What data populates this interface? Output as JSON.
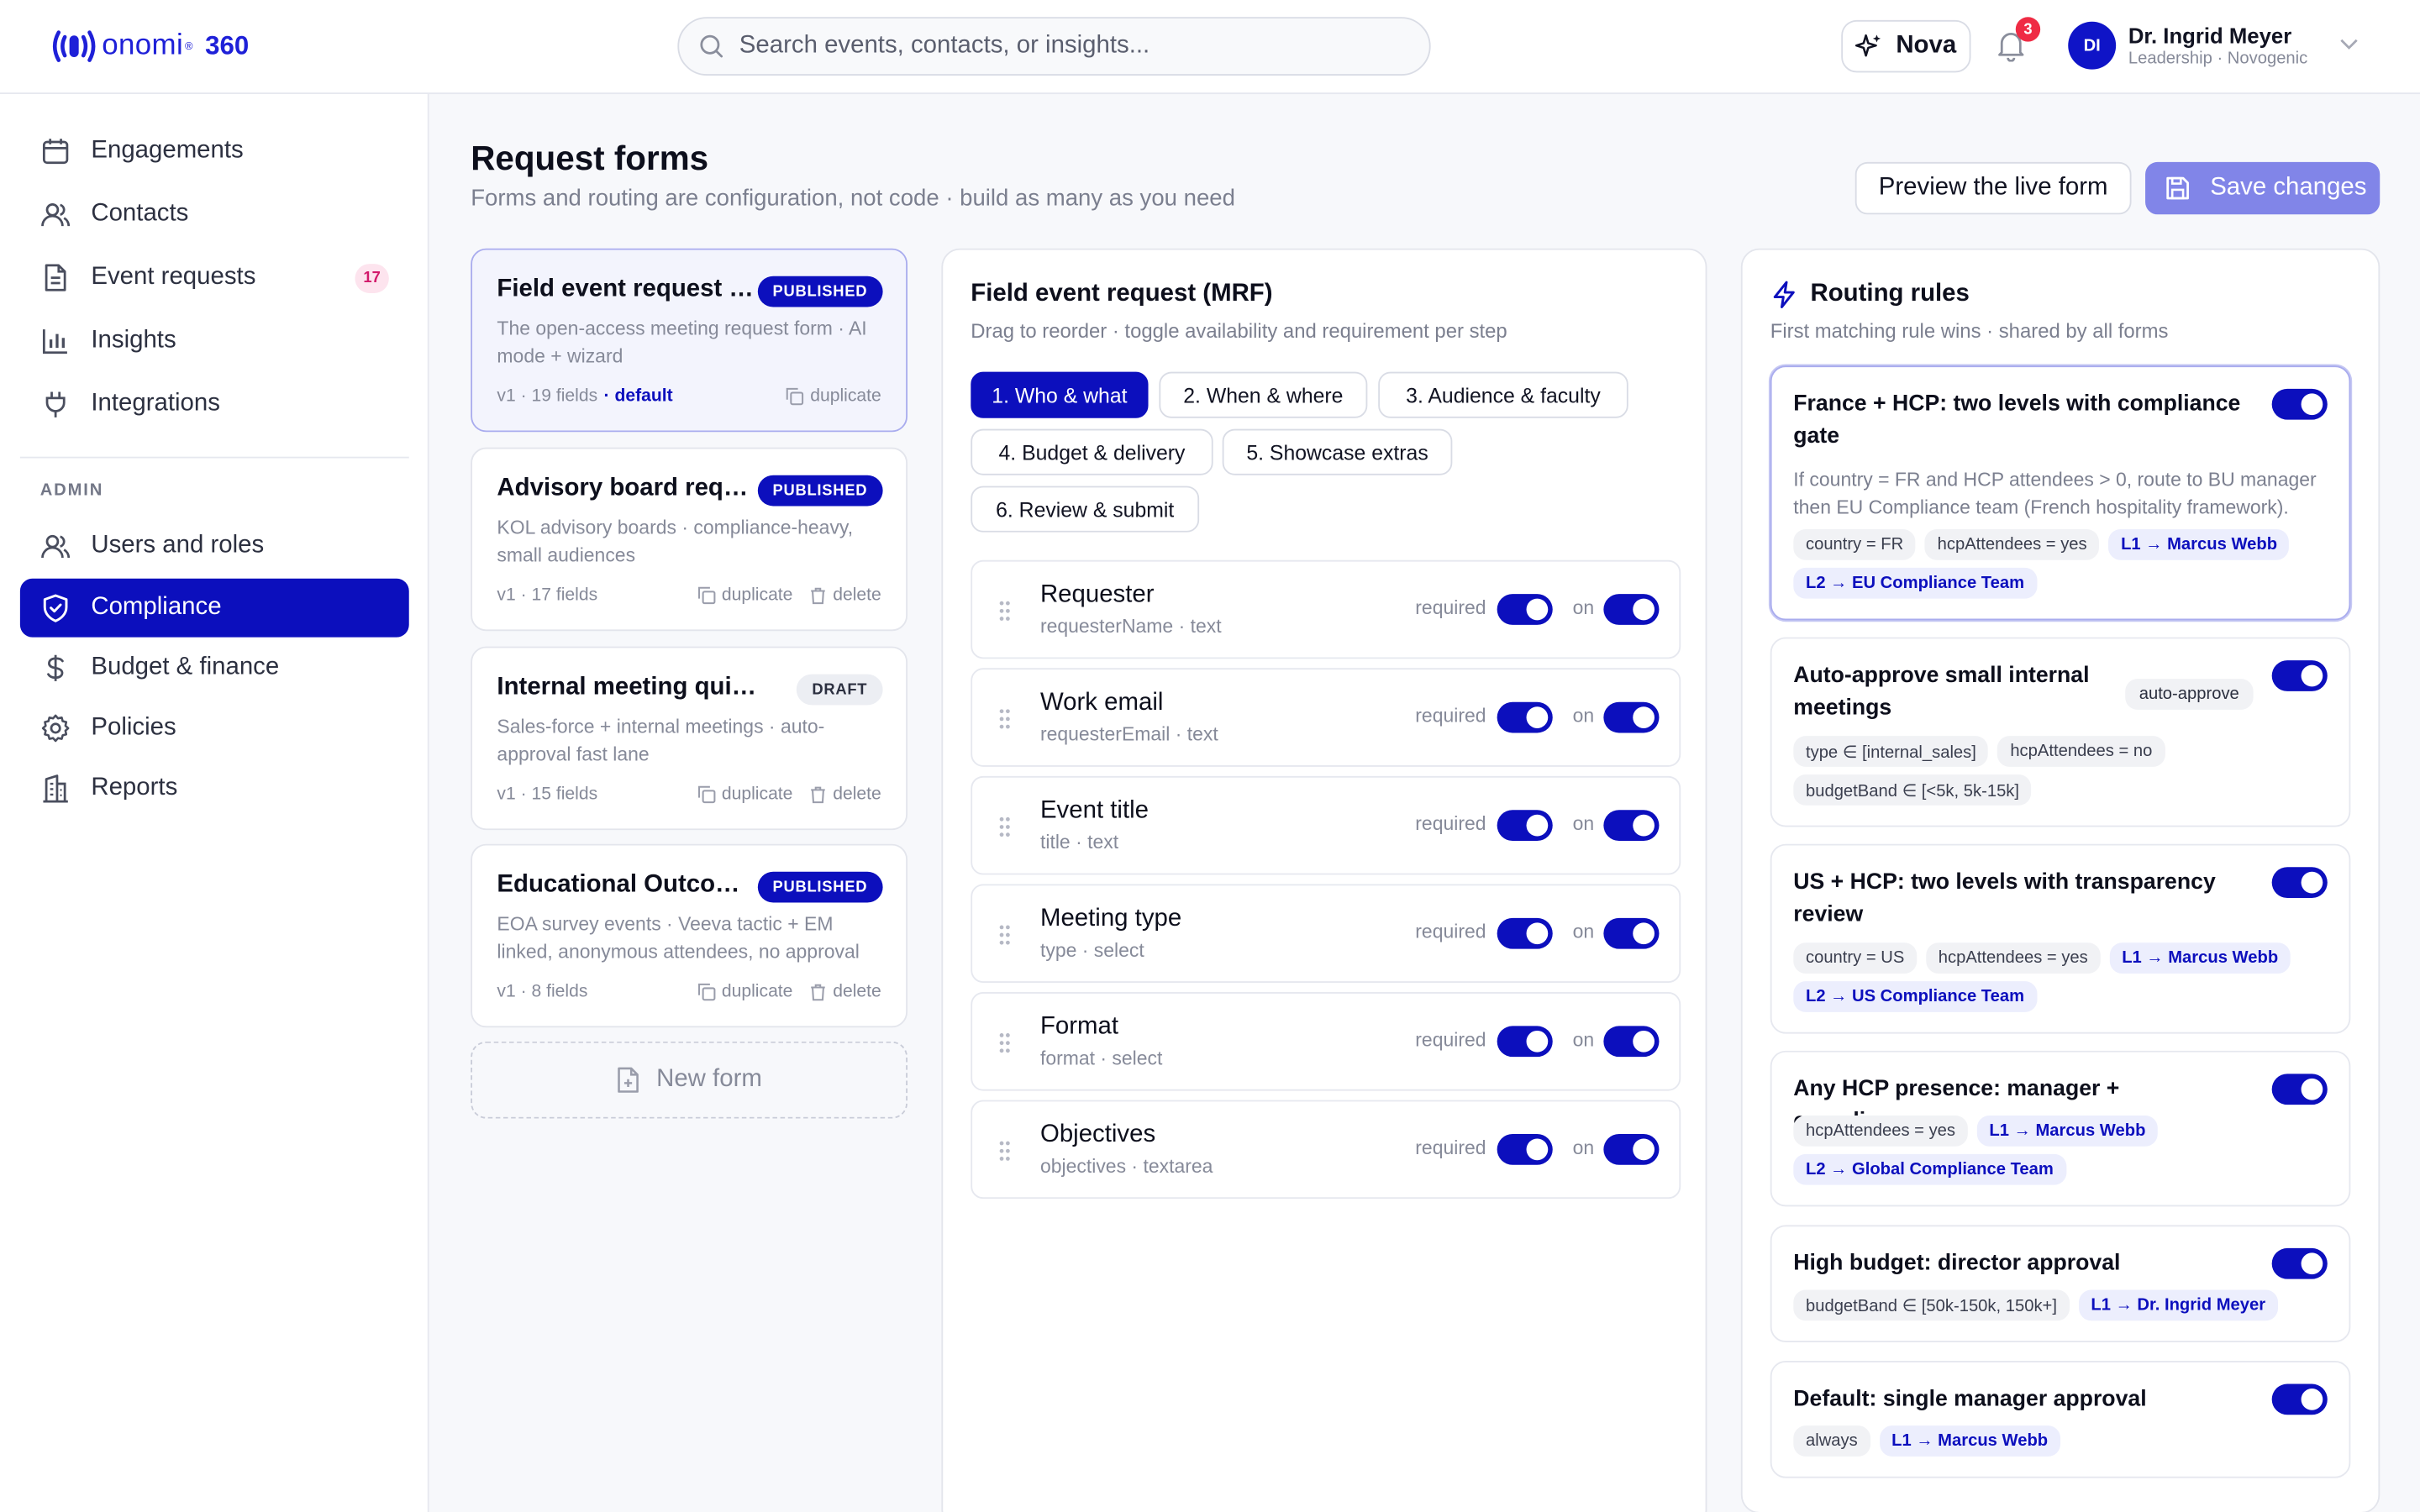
{
  "brand": {
    "name": "onomi",
    "suffix": "360"
  },
  "search": {
    "placeholder": "Search events, contacts, or insights..."
  },
  "header": {
    "assistant_label": "Nova",
    "notification_count": "3",
    "user_initials": "DI",
    "user_name": "Dr. Ingrid Meyer",
    "user_role": "Leadership · Novogenic"
  },
  "sidebar": {
    "items": [
      {
        "label": "Engagements",
        "icon": "calendar-icon"
      },
      {
        "label": "Contacts",
        "icon": "users-icon"
      },
      {
        "label": "Event requests",
        "icon": "document-icon",
        "badge": "17"
      },
      {
        "label": "Insights",
        "icon": "bar-chart-icon"
      },
      {
        "label": "Integrations",
        "icon": "plug-icon"
      }
    ],
    "admin_label": "ADMIN",
    "admin_items": [
      {
        "label": "Users and roles",
        "icon": "users-icon"
      },
      {
        "label": "Compliance",
        "icon": "shield-icon",
        "active": true
      },
      {
        "label": "Budget & finance",
        "icon": "dollar-icon"
      },
      {
        "label": "Policies",
        "icon": "gear-icon"
      },
      {
        "label": "Reports",
        "icon": "building-icon"
      }
    ]
  },
  "page": {
    "title": "Request forms",
    "subtitle": "Forms and routing are configuration, not code · build as many as you need",
    "preview_label": "Preview the live form",
    "save_label": "Save changes"
  },
  "forms": [
    {
      "title": "Field event request (MRF)",
      "status": "PUBLISHED",
      "desc": "The open-access meeting request form · AI mode + wizard",
      "meta": "v1 · 19 fields",
      "default": "· default",
      "duplicate": "duplicate"
    },
    {
      "title": "Advisory board request",
      "status": "PUBLISHED",
      "desc": "KOL advisory boards · compliance-heavy, small audiences",
      "meta": "v1 · 17 fields",
      "duplicate": "duplicate",
      "delete": "delete"
    },
    {
      "title": "Internal meeting quick form",
      "status": "DRAFT",
      "desc": "Sales-force + internal meetings · auto-approval fast lane",
      "meta": "v1 · 15 fields",
      "duplicate": "duplicate",
      "delete": "delete"
    },
    {
      "title": "Educational Outcomes Assessment",
      "status": "PUBLISHED",
      "desc": "EOA survey events · Veeva tactic + EM linked, anonymous attendees, no approval",
      "meta": "v1 · 8 fields",
      "duplicate": "duplicate",
      "delete": "delete"
    }
  ],
  "new_form_label": "New form",
  "editor": {
    "title": "Field event request (MRF)",
    "subtitle": "Drag to reorder · toggle availability and requirement per step",
    "steps": [
      "1. Who & what",
      "2. When & where",
      "3. Audience & faculty",
      "4. Budget & delivery",
      "5. Showcase extras",
      "6. Review & submit"
    ],
    "required_label": "required",
    "on_label": "on",
    "fields": [
      {
        "name": "Requester",
        "key": "requesterName · text"
      },
      {
        "name": "Work email",
        "key": "requesterEmail · text"
      },
      {
        "name": "Event title",
        "key": "title · text"
      },
      {
        "name": "Meeting type",
        "key": "type · select"
      },
      {
        "name": "Format",
        "key": "format · select"
      },
      {
        "name": "Objectives",
        "key": "objectives · textarea"
      }
    ]
  },
  "routing": {
    "title": "Routing rules",
    "subtitle": "First matching rule wins · shared by all forms",
    "rules": [
      {
        "title": "France + HCP: two levels with compliance gate",
        "desc": "If country = FR and HCP attendees > 0, route to BU manager then EU Compliance team (French hospitality framework).",
        "chips": [
          "country = FR",
          "hcpAttendees = yes"
        ],
        "routes": [
          "L1 → Marcus Webb",
          "L2 → EU Compliance Team"
        ]
      },
      {
        "title": "Auto-approve small internal meetings",
        "tag": "auto-approve",
        "chips": [
          "type ∈ [internal_sales]",
          "hcpAttendees = no",
          "budgetBand ∈ [<5k, 5k-15k]"
        ],
        "routes": []
      },
      {
        "title": "US + HCP: two levels with transparency review",
        "chips": [
          "country = US",
          "hcpAttendees = yes"
        ],
        "routes": [
          "L1 → Marcus Webb",
          "L2 → US Compliance Team"
        ]
      },
      {
        "title": "Any HCP presence: manager + compliance",
        "chips": [
          "hcpAttendees = yes"
        ],
        "routes": [
          "L1 → Marcus Webb",
          "L2 → Global Compliance Team"
        ]
      },
      {
        "title": "High budget: director approval",
        "chips": [
          "budgetBand ∈ [50k-150k, 150k+]"
        ],
        "routes": [
          "L1 → Dr. Ingrid Meyer"
        ]
      },
      {
        "title": "Default: single manager approval",
        "chips": [
          "always"
        ],
        "routes": [
          "L1 → Marcus Webb"
        ]
      }
    ]
  },
  "colors": {
    "accent": "#0c0fbd",
    "save_button": "#8185e8",
    "badge_red": "#ef2b44"
  }
}
